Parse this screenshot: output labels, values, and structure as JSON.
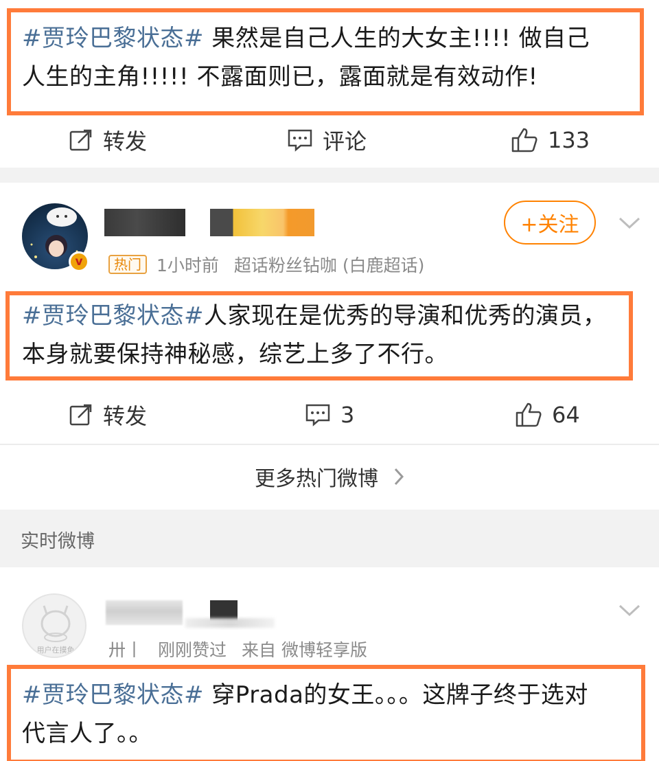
{
  "posts": [
    {
      "topic": "#贾玲巴黎状态#",
      "text_line1": " 果然是自己人生的大女主!!!! 做自己",
      "text_line2": "人生的主角!!!!! 不露面则已，露面就是有效动作!",
      "actions": {
        "repost": "转发",
        "comment": "评论",
        "like": "133"
      }
    },
    {
      "hot_tag": "热门",
      "time": "1小时前",
      "source": "超话粉丝钻咖 (白鹿超话)",
      "follow_label": "+关注",
      "topic": "#贾玲巴黎状态#",
      "text_line1": "人家现在是优秀的导演和优秀的演员，",
      "text_line2": "本身就要保持神秘感，综艺上多了不行。",
      "actions": {
        "repost": "转发",
        "comment": "3",
        "like": "64"
      }
    },
    {
      "meta_prefix": "卅丨",
      "liked": "刚刚赞过",
      "source": "来自 微博轻享版",
      "avatar_caption": "用户在摸鱼",
      "topic": "#贾玲巴黎状态#",
      "text_line1": "  穿Prada的女王。。。这牌子终于选对",
      "text_line2": "代言人了。。"
    }
  ],
  "more_hot": "更多热门微博",
  "realtime_header": "实时微博",
  "colors": {
    "accent": "#ff8200",
    "highlight": "#ff7b3a",
    "topic": "#4a6f96"
  }
}
